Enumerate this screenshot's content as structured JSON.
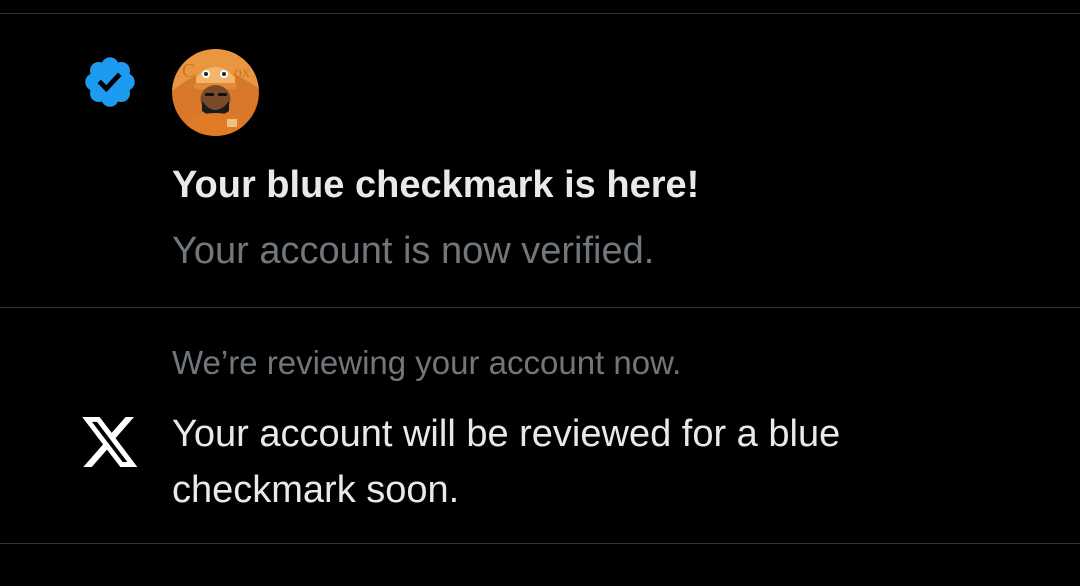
{
  "notifications": [
    {
      "icon": "verified-badge-icon",
      "icon_color": "#1d9bf0",
      "title": "Your blue checkmark is here!",
      "subtitle": "Your account is now verified."
    },
    {
      "icon": "x-logo-icon",
      "icon_color": "#ffffff",
      "header": "We’re reviewing your account now.",
      "body": "Your account will be reviewed for a blue checkmark soon."
    }
  ],
  "colors": {
    "background": "#000000",
    "divider": "#2f3336",
    "primary_text": "#e7e9ea",
    "secondary_text": "#71767b",
    "accent": "#1d9bf0",
    "avatar_orange": "#e8862a"
  }
}
